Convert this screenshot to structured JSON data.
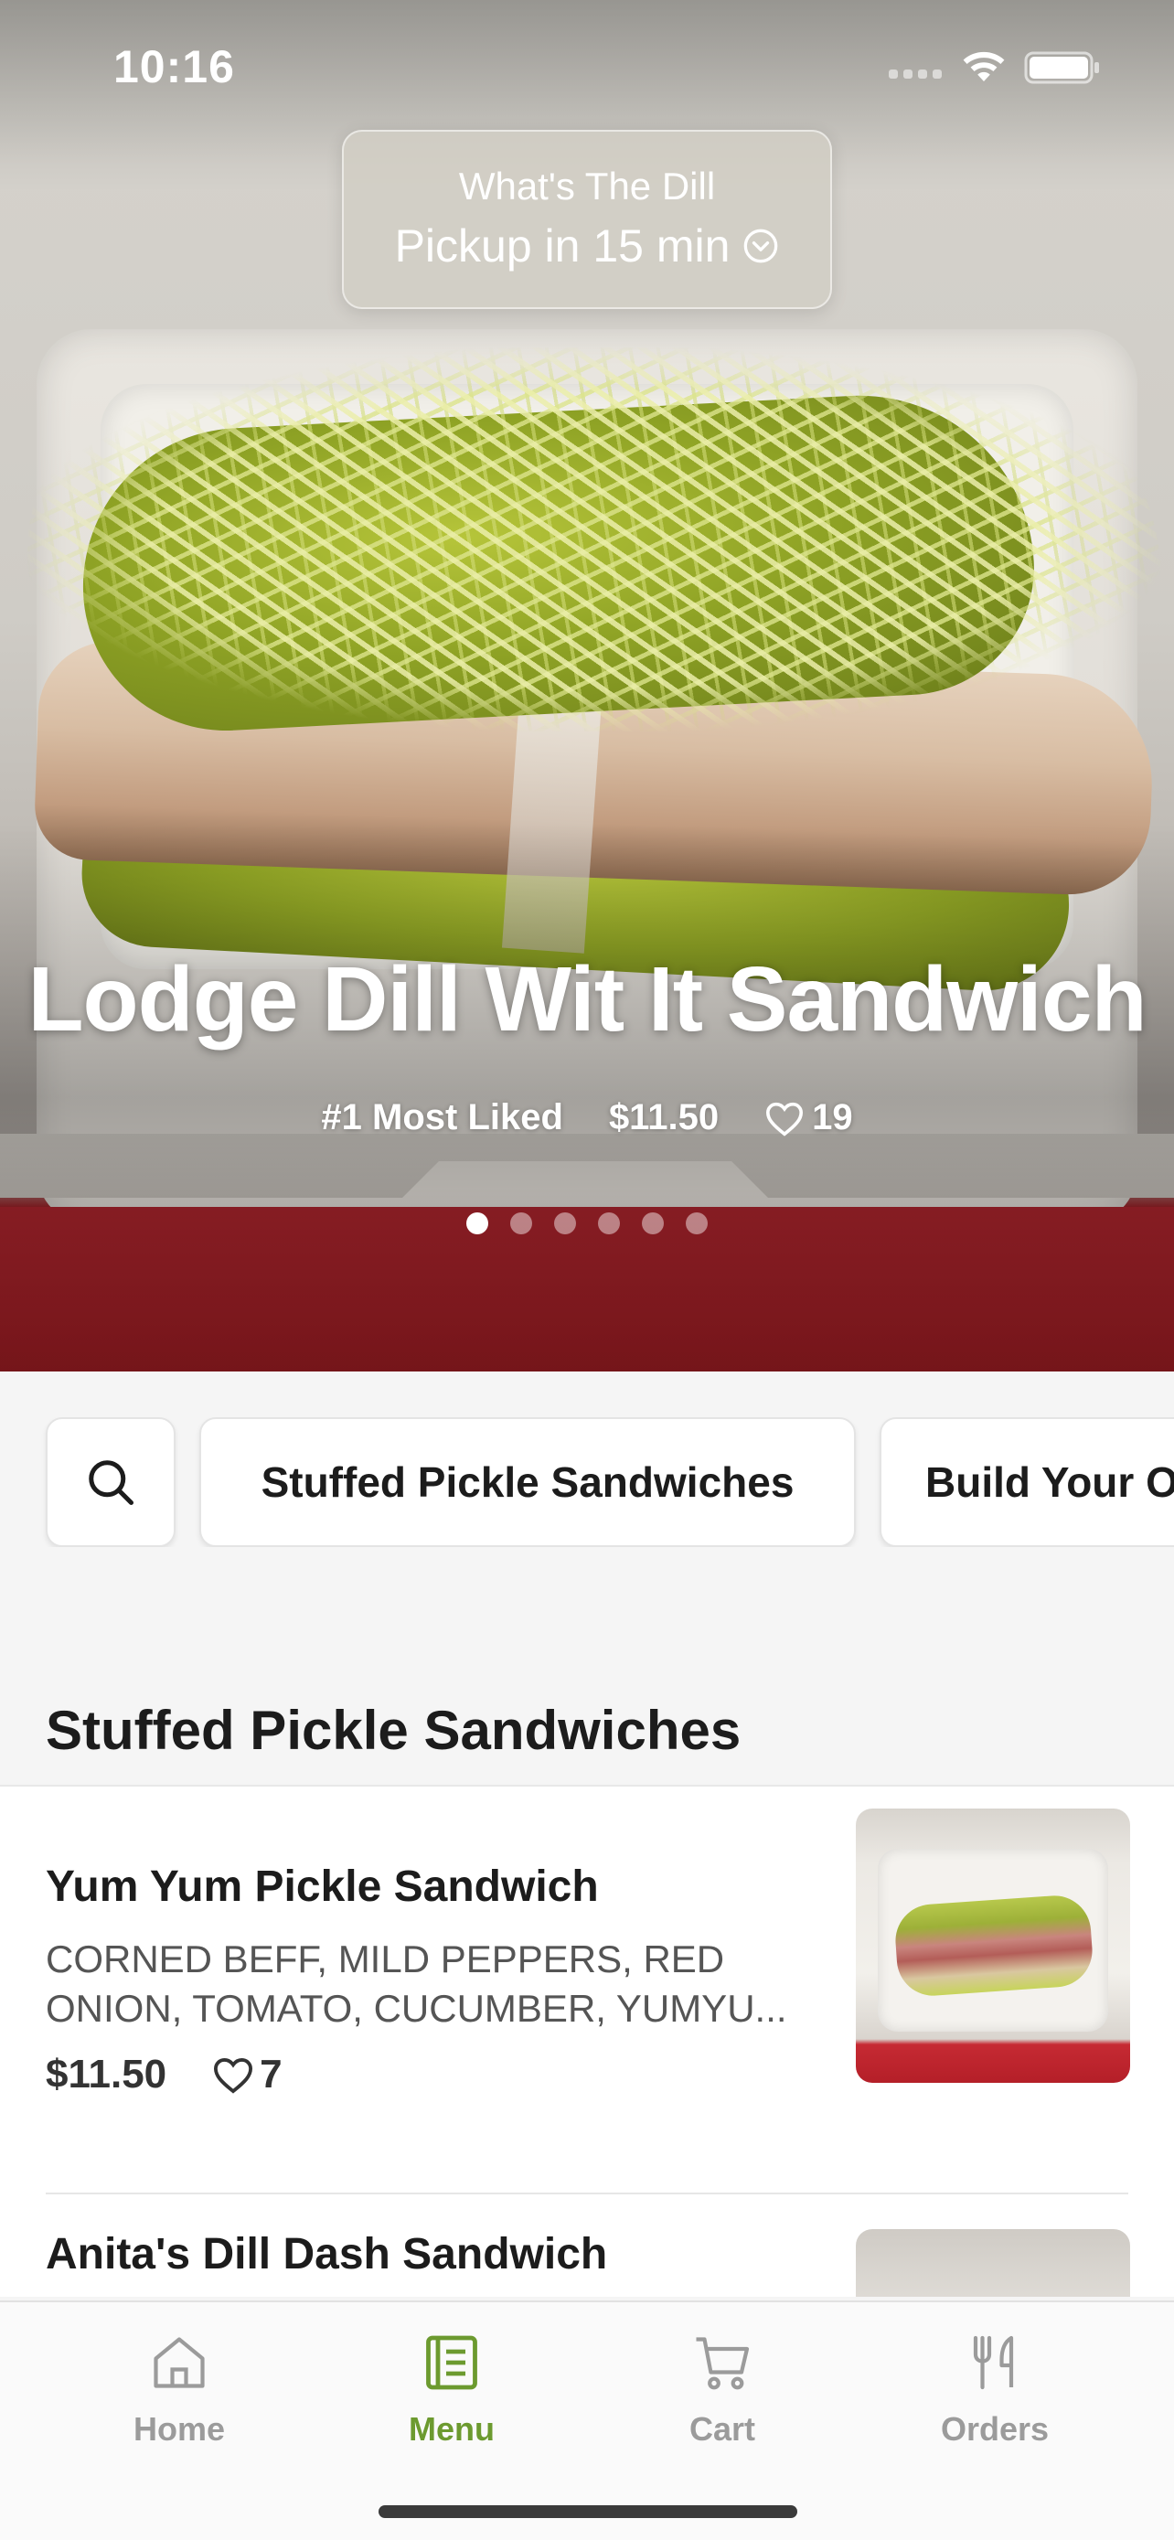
{
  "status_bar": {
    "time": "10:16"
  },
  "pickup": {
    "store_name": "What's The Dill",
    "pickup_time": "Pickup in 15 min"
  },
  "hero": {
    "title": "Lodge Dill Wit It Sandwich",
    "rank": "#1 Most Liked",
    "price": "$11.50",
    "likes": "19",
    "carousel_pages": 6,
    "carousel_active": 1
  },
  "categories": {
    "items": [
      "Stuffed Pickle Sandwiches",
      "Build Your O"
    ]
  },
  "section": {
    "title": "Stuffed Pickle Sandwiches",
    "items": [
      {
        "name": "Yum Yum Pickle Sandwich",
        "description": "CORNED BEFF, MILD PEPPERS, RED ONION, TOMATO, CUCUMBER, YUMYU...",
        "price": "$11.50",
        "likes": "7"
      },
      {
        "name": "Anita's Dill Dash Sandwich"
      }
    ]
  },
  "tab_bar": {
    "tabs": [
      {
        "label": "Home",
        "icon": "home-icon"
      },
      {
        "label": "Menu",
        "icon": "menu-icon",
        "active": true
      },
      {
        "label": "Cart",
        "icon": "cart-icon"
      },
      {
        "label": "Orders",
        "icon": "orders-icon"
      }
    ]
  },
  "colors": {
    "accent": "#6c9a2f",
    "inactive_tab": "#9b9b9b",
    "tray_red": "#a1222a"
  }
}
